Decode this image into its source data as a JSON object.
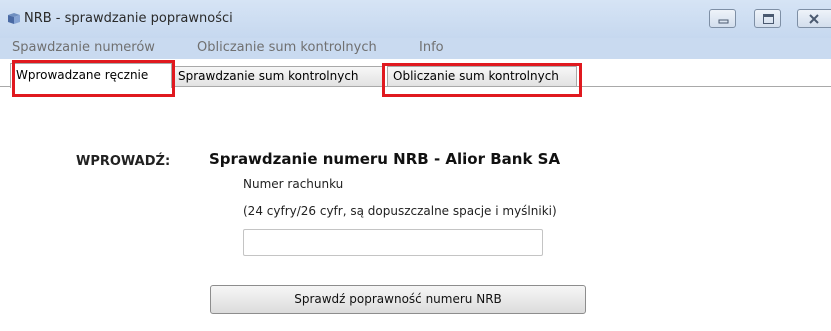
{
  "window": {
    "title": "NRB - sprawdzanie poprawności",
    "controls": [
      "minimize-icon",
      "maximize-icon",
      "close-icon"
    ]
  },
  "menu": {
    "items": [
      {
        "label": "Spawdzanie numerów"
      },
      {
        "label": "Obliczanie sum kontrolnych"
      },
      {
        "label": "Info"
      }
    ]
  },
  "tabs": [
    {
      "label": "Wprowadzane ręcznie",
      "active": true,
      "highlighted": true
    },
    {
      "label": "Sprawdzanie sum kontrolnych",
      "active": false,
      "highlighted": false
    },
    {
      "label": "Obliczanie sum kontrolnych",
      "active": false,
      "highlighted": true
    }
  ],
  "form": {
    "section_label": "WPROWADŹ:",
    "heading": "Sprawdzanie numeru NRB - Alior Bank SA",
    "field_label": "Numer rachunku",
    "hint": "(24 cyfry/26 cyfr, są dopuszczalne spacje i myślniki)",
    "account_value": "",
    "button_label": "Sprawdź poprawność numeru NRB"
  },
  "colors": {
    "titlebar": "#c6d8ef",
    "menubar": "#c9daf0",
    "highlight": "#e0191f",
    "menu_text": "#707070"
  }
}
